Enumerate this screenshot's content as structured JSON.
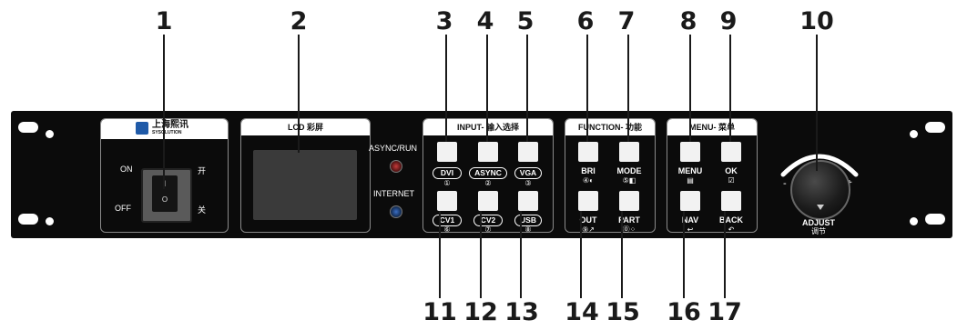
{
  "callouts": {
    "n1": "1",
    "n2": "2",
    "n3": "3",
    "n4": "4",
    "n5": "5",
    "n6": "6",
    "n7": "7",
    "n8": "8",
    "n9": "9",
    "n10": "10",
    "n11": "11",
    "n12": "12",
    "n13": "13",
    "n14": "14",
    "n15": "15",
    "n16": "16",
    "n17": "17"
  },
  "power": {
    "brand": "上海熙讯",
    "brand_sub": "SYSOLUTION",
    "on_label": "ON",
    "off_label": "OFF",
    "on_cn": "开",
    "off_cn": "关",
    "switch_on_mark": "I",
    "switch_off_mark": "O"
  },
  "lcd": {
    "title": "LCD 彩屏"
  },
  "indicators": {
    "async_run": "ASYNC/RUN",
    "internet": "INTERNET"
  },
  "input": {
    "title": "INPUT- 输入选择",
    "buttons": [
      {
        "label": "DVI",
        "sub": "①"
      },
      {
        "label": "ASYNC",
        "sub": "②"
      },
      {
        "label": "VGA",
        "sub": "③"
      },
      {
        "label": "CV1",
        "sub": "⑥"
      },
      {
        "label": "CV2",
        "sub": "⑦"
      },
      {
        "label": "USB",
        "sub": "⑧"
      }
    ]
  },
  "function": {
    "title": "FUNCTION- 功能",
    "buttons": [
      {
        "label": "BRI",
        "sub": "④◐"
      },
      {
        "label": "MODE",
        "sub": "⑤◧"
      },
      {
        "label": "OUT",
        "sub": "⑨↗"
      },
      {
        "label": "PART",
        "sub": "⓪⁘"
      }
    ]
  },
  "menu": {
    "title": "MENU- 菜单",
    "buttons": [
      {
        "label": "MENU",
        "sub": "▤"
      },
      {
        "label": "OK",
        "sub": "☑"
      },
      {
        "label": "NAV",
        "sub": "↩"
      },
      {
        "label": "BACK",
        "sub": "↶"
      }
    ]
  },
  "knob": {
    "label": "ADJUST",
    "label_cn": "调节",
    "minus": "-",
    "plus": "+"
  }
}
